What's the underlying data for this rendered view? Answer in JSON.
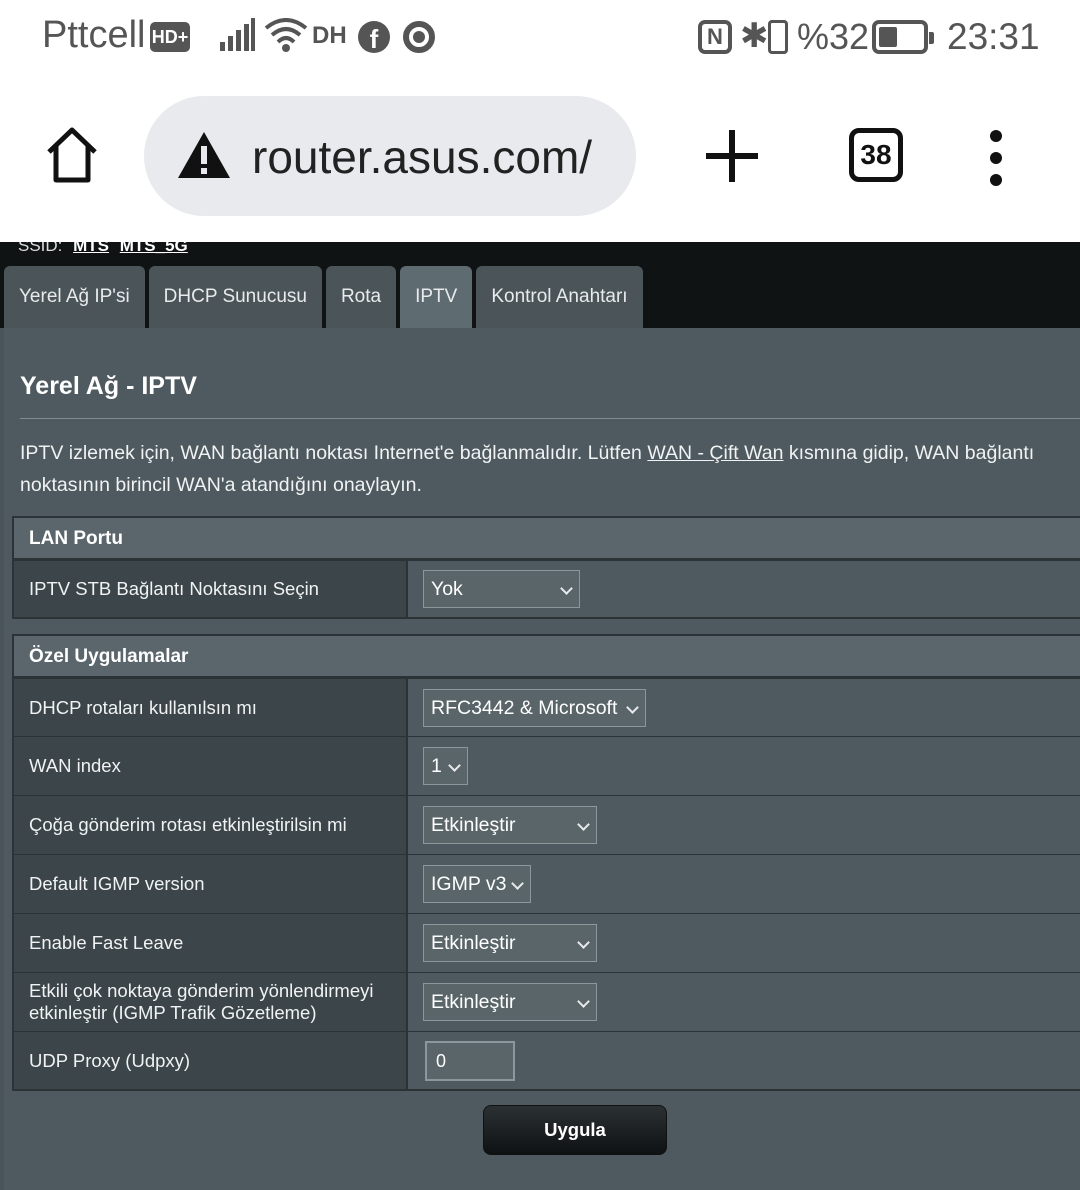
{
  "status_bar": {
    "carrier": "Pttcell",
    "hd_badge": "HD+",
    "dh_label": "DH",
    "battery_text": "%32",
    "battery_level": 0.32,
    "time": "23:31"
  },
  "browser": {
    "url": "router.asus.com/",
    "tab_count": "38"
  },
  "router": {
    "ssid_label": "SSID:",
    "ssid_1": "MTS",
    "ssid_2": "MTS_5G",
    "tabs": [
      {
        "label": "Yerel Ağ IP'si"
      },
      {
        "label": "DHCP Sunucusu"
      },
      {
        "label": "Rota"
      },
      {
        "label": "IPTV"
      },
      {
        "label": "Kontrol Anahtarı"
      }
    ],
    "active_tab": "IPTV",
    "page_title": "Yerel Ağ - IPTV",
    "description_before": "IPTV izlemek için, WAN bağlantı noktası Internet'e bağlanmalıdır. Lütfen ",
    "description_link": "WAN - Çift Wan",
    "description_after": " kısmına gidip, WAN bağlantı noktasının birincil WAN'a atandığını onaylayın.",
    "lan_section": {
      "header": "LAN Portu",
      "rows": [
        {
          "label": "IPTV STB Bağlantı Noktasını Seçin",
          "value": "Yok"
        }
      ]
    },
    "special_section": {
      "header": "Özel Uygulamalar",
      "rows": [
        {
          "label": "DHCP rotaları kullanılsın mı",
          "value": "RFC3442 & Microsoft"
        },
        {
          "label": "WAN index",
          "value": "1"
        },
        {
          "label": "Çoğa gönderim rotası etkinleştirilsin mi",
          "value": "Etkinleştir"
        },
        {
          "label": "Default IGMP version",
          "value": "IGMP v3"
        },
        {
          "label": "Enable Fast Leave",
          "value": "Etkinleştir"
        },
        {
          "label": "Etkili çok noktaya gönderim yönlendirmeyi etkinleştir (IGMP Trafik Gözetleme)",
          "value": "Etkinleştir"
        },
        {
          "label": "UDP Proxy (Udpxy)",
          "value": "0"
        }
      ]
    },
    "apply_button": "Uygula"
  }
}
